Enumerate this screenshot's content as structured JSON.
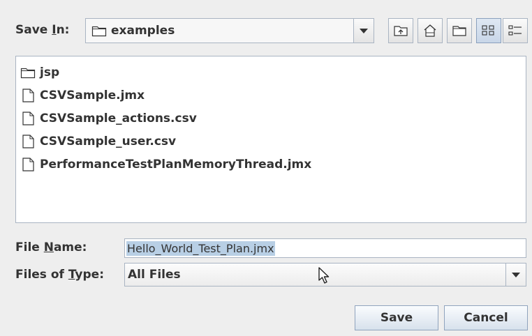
{
  "save_in": {
    "label_prefix": "Save ",
    "label_mnemonic": "I",
    "label_suffix": "n:",
    "folder": "examples"
  },
  "toolbar": {
    "icons": [
      "up-folder-icon",
      "home-icon",
      "new-folder-icon",
      "list-view-icon",
      "details-view-icon"
    ]
  },
  "files": [
    {
      "name": "jsp",
      "type": "folder"
    },
    {
      "name": "CSVSample.jmx",
      "type": "file"
    },
    {
      "name": "CSVSample_actions.csv",
      "type": "file"
    },
    {
      "name": "CSVSample_user.csv",
      "type": "file"
    },
    {
      "name": "PerformanceTestPlanMemoryThread.jmx",
      "type": "file"
    }
  ],
  "file_name": {
    "label_prefix": "File ",
    "label_mnemonic": "N",
    "label_suffix": "ame:",
    "value": "Hello_World_Test_Plan.jmx"
  },
  "files_of_type": {
    "label_prefix": "Files of ",
    "label_mnemonic": "T",
    "label_suffix": "ype:",
    "value": "All Files"
  },
  "buttons": {
    "save": "Save",
    "cancel": "Cancel"
  }
}
